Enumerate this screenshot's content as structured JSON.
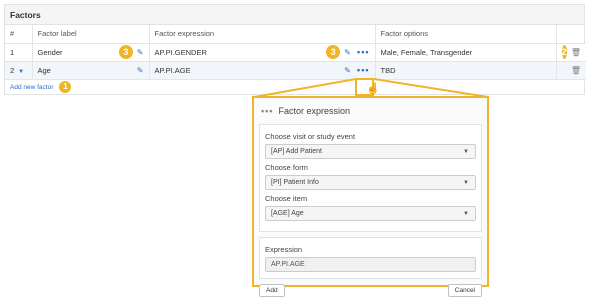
{
  "panel": {
    "title": "Factors"
  },
  "columns": [
    "#",
    "Factor label",
    "Factor expression",
    "Factor options"
  ],
  "rows": [
    {
      "num": "1",
      "label": "Gender",
      "expression": "AP.PI.GENDER",
      "options": "Male, Female, Transgender",
      "options_muted": false
    },
    {
      "num": "2",
      "label": "Age",
      "expression": "AP.PI.AGE",
      "options": "TBD",
      "options_muted": true
    }
  ],
  "add_link": "Add new factor",
  "badges": {
    "label": "3",
    "expression": "3",
    "add": "1",
    "delete": "2"
  },
  "popup": {
    "title": "Factor expression",
    "visit_label": "Choose visit or study event",
    "visit_value": "[AP] Add Patient",
    "form_label": "Choose form",
    "form_value": "[PI] Patient Info",
    "item_label": "Choose item",
    "item_value": "[AGE] Age",
    "expression_label": "Expression",
    "expression_value": "AP.PI.AGE",
    "add_button": "Add",
    "cancel_button": "Cancel"
  },
  "colors": {
    "accent": "#f0b429",
    "link": "#2a6bd6"
  }
}
